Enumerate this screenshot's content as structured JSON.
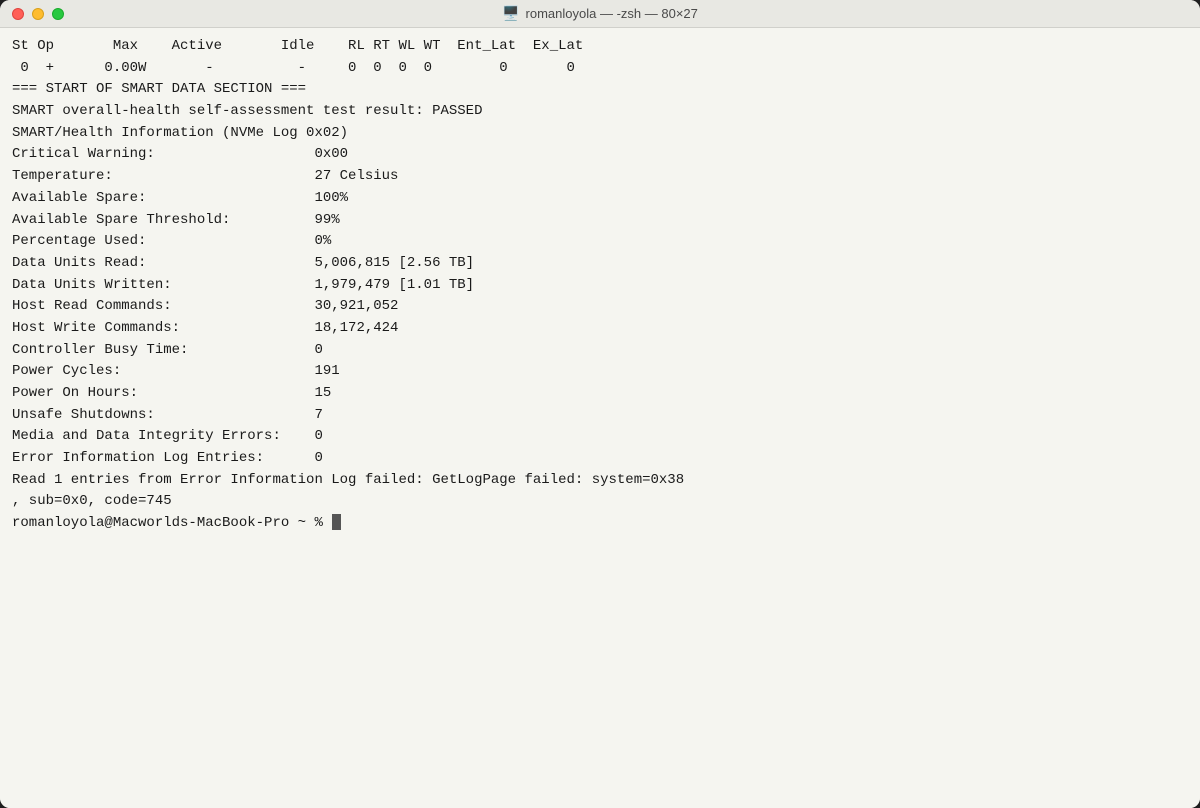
{
  "titlebar": {
    "title": "romanloyola — -zsh — 80×27",
    "icon": "🖥️"
  },
  "terminal": {
    "lines": [
      "St Op       Max    Active       Idle    RL RT WL WT  Ent_Lat  Ex_Lat",
      " 0  +      0.00W       -          -     0  0  0  0        0       0",
      "",
      "=== START OF SMART DATA SECTION ===",
      "SMART overall-health self-assessment test result: PASSED",
      "",
      "SMART/Health Information (NVMe Log 0x02)",
      "Critical Warning:                   0x00",
      "Temperature:                        27 Celsius",
      "Available Spare:                    100%",
      "Available Spare Threshold:          99%",
      "Percentage Used:                    0%",
      "Data Units Read:                    5,006,815 [2.56 TB]",
      "Data Units Written:                 1,979,479 [1.01 TB]",
      "Host Read Commands:                 30,921,052",
      "Host Write Commands:                18,172,424",
      "Controller Busy Time:               0",
      "Power Cycles:                       191",
      "Power On Hours:                     15",
      "Unsafe Shutdowns:                   7",
      "Media and Data Integrity Errors:    0",
      "Error Information Log Entries:      0",
      "",
      "Read 1 entries from Error Information Log failed: GetLogPage failed: system=0x38",
      ", sub=0x0, code=745",
      "",
      "romanloyola@Macworlds-MacBook-Pro ~ % "
    ],
    "prompt": "romanloyola@Macworlds-MacBook-Pro ~ % "
  }
}
